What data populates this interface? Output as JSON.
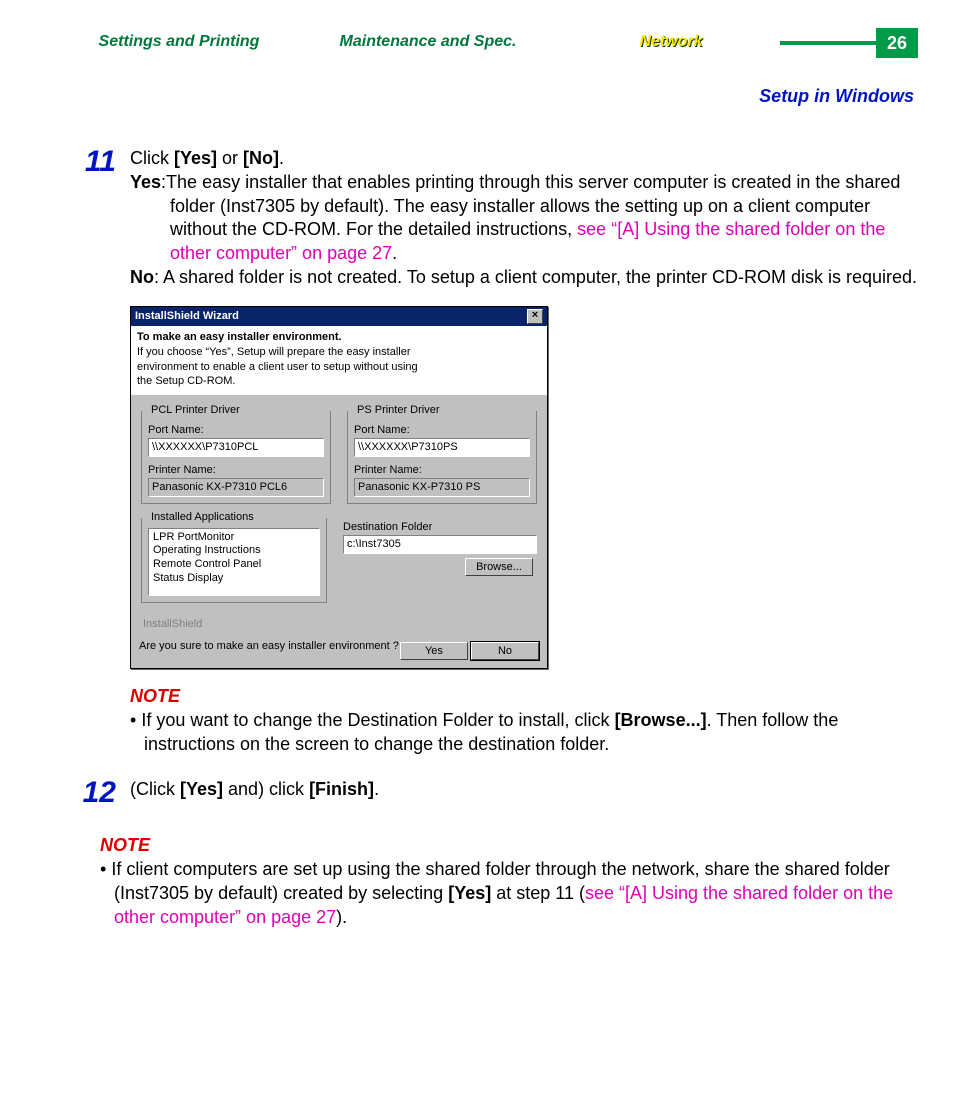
{
  "tabs": {
    "settings": "Settings and Printing",
    "maintenance": "Maintenance and Spec.",
    "network": "Network"
  },
  "page_number": "26",
  "subtitle": "Setup in Windows",
  "step11": {
    "num": "11",
    "head_a": "Click ",
    "head_b": "[Yes]",
    "head_c": " or ",
    "head_d": "[No]",
    "head_e": ".",
    "yes_lbl": "Yes",
    "yes_txt_a": ":The easy installer that enables printing through this server computer is created in the shared folder (Inst7305 by default). The easy installer allows the setting up on a client computer without the CD-ROM.  For the detailed instructions, ",
    "yes_link": "see “[A] Using the shared folder on the other computer” on page 27",
    "yes_txt_b": ".",
    "no_lbl": "No",
    "no_txt": ": A shared folder is not created. To setup a client computer, the printer CD-ROM disk is required."
  },
  "dialog": {
    "title": "InstallShield Wizard",
    "head_t": "To make an easy installer environment.",
    "head_d": "If you choose “Yes”, Setup will prepare the easy installer environment to enable a client user to setup without using the Setup CD-ROM.",
    "pcl": {
      "grp": "PCL Printer Driver",
      "port_lbl": "Port Name:",
      "port": "\\\\XXXXXX\\P7310PCL",
      "printer_lbl": "Printer Name:",
      "printer": "Panasonic KX-P7310 PCL6"
    },
    "ps": {
      "grp": "PS Printer Driver",
      "port_lbl": "Port Name:",
      "port": "\\\\XXXXXX\\P7310PS",
      "printer_lbl": "Printer Name:",
      "printer": "Panasonic KX-P7310 PS"
    },
    "apps": {
      "grp": "Installed Applications",
      "items": [
        "LPR PortMonitor",
        "Operating Instructions",
        "Remote Control Panel",
        "Status Display"
      ]
    },
    "dest_lbl": "Destination Folder",
    "dest": "c:\\Inst7305",
    "browse": "Browse...",
    "brand": "InstallShield",
    "question": "Are you sure to make an easy installer environment ?",
    "yes": "Yes",
    "no": "No"
  },
  "note1": {
    "lbl": "NOTE",
    "a": "If you want to change the Destination Folder to install, click ",
    "b": "[Browse...]",
    "c": ". Then follow the instructions on the screen to change the destination folder."
  },
  "step12": {
    "num": "12",
    "a": "(Click ",
    "b": "[Yes]",
    "c": " and) click ",
    "d": "[Finish]",
    "e": "."
  },
  "note2": {
    "lbl": "NOTE",
    "a": "If client computers are set up using the shared folder through the network, share the shared folder (Inst7305 by default) created by selecting ",
    "b": "[Yes]",
    "c": " at step 11 (",
    "link": "see “[A] Using the shared folder on the other computer” on page 27",
    "d": ")."
  }
}
